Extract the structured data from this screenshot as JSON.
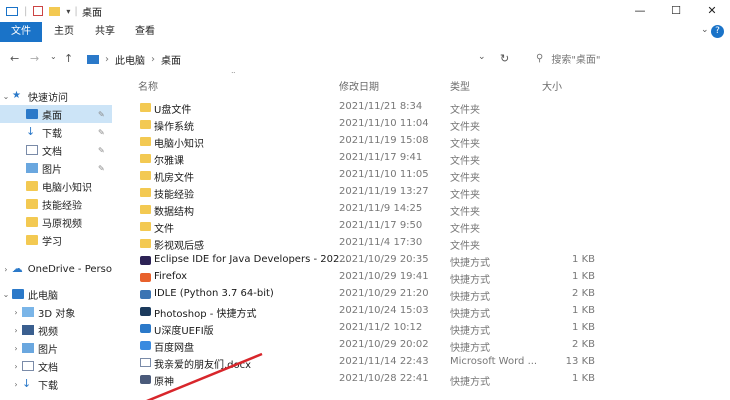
{
  "window": {
    "title": "桌面",
    "minimize": "—",
    "maximize": "☐",
    "close": "✕"
  },
  "ribbon": {
    "tabs": [
      "文件",
      "主页",
      "共享",
      "查看"
    ],
    "help": "?"
  },
  "address": {
    "crumbs": [
      "此电脑",
      "桌面"
    ],
    "search_placeholder": "搜索\"桌面\""
  },
  "nav": {
    "quick_access": "快速访问",
    "items": [
      {
        "label": "桌面",
        "pinned": true,
        "icon": "desktop-icon"
      },
      {
        "label": "下载",
        "pinned": true,
        "icon": "download-icon"
      },
      {
        "label": "文档",
        "pinned": true,
        "icon": "document-icon"
      },
      {
        "label": "图片",
        "pinned": true,
        "icon": "picture-icon"
      },
      {
        "label": "电脑小知识",
        "pinned": false,
        "icon": "folder-icon"
      },
      {
        "label": "技能经验",
        "pinned": false,
        "icon": "folder-icon"
      },
      {
        "label": "马原视频",
        "pinned": false,
        "icon": "folder-icon"
      },
      {
        "label": "学习",
        "pinned": false,
        "icon": "folder-icon"
      }
    ],
    "onedrive": "OneDrive - Perso",
    "this_pc": "此电脑",
    "pc_items": [
      {
        "label": "3D 对象",
        "icon": "3d-objects-icon"
      },
      {
        "label": "视频",
        "icon": "video-icon"
      },
      {
        "label": "图片",
        "icon": "picture-icon"
      },
      {
        "label": "文档",
        "icon": "document-icon"
      },
      {
        "label": "下载",
        "icon": "download-icon"
      }
    ]
  },
  "columns": {
    "name": "名称",
    "modified": "修改日期",
    "type": "类型",
    "size": "大小"
  },
  "files": [
    {
      "name": "U盘文件",
      "date": "2021/11/21 8:34",
      "type": "文件夹",
      "size": "",
      "icon": "folder"
    },
    {
      "name": "操作系统",
      "date": "2021/11/10 11:04",
      "type": "文件夹",
      "size": "",
      "icon": "folder"
    },
    {
      "name": "电脑小知识",
      "date": "2021/11/19 15:08",
      "type": "文件夹",
      "size": "",
      "icon": "folder"
    },
    {
      "name": "尔雅课",
      "date": "2021/11/17 9:41",
      "type": "文件夹",
      "size": "",
      "icon": "folder"
    },
    {
      "name": "机房文件",
      "date": "2021/11/10 11:05",
      "type": "文件夹",
      "size": "",
      "icon": "folder"
    },
    {
      "name": "技能经验",
      "date": "2021/11/19 13:27",
      "type": "文件夹",
      "size": "",
      "icon": "folder"
    },
    {
      "name": "数据结构",
      "date": "2021/11/9 14:25",
      "type": "文件夹",
      "size": "",
      "icon": "folder"
    },
    {
      "name": "文件",
      "date": "2021/11/17 9:50",
      "type": "文件夹",
      "size": "",
      "icon": "folder"
    },
    {
      "name": "影视观后感",
      "date": "2021/11/4 17:30",
      "type": "文件夹",
      "size": "",
      "icon": "folder"
    },
    {
      "name": "Eclipse IDE for Java Developers - 202...",
      "date": "2021/10/29 20:35",
      "type": "快捷方式",
      "size": "1 KB",
      "icon": "eclipse"
    },
    {
      "name": "Firefox",
      "date": "2021/10/29 19:41",
      "type": "快捷方式",
      "size": "1 KB",
      "icon": "firefox"
    },
    {
      "name": "IDLE (Python 3.7 64-bit)",
      "date": "2021/10/29 21:20",
      "type": "快捷方式",
      "size": "2 KB",
      "icon": "python"
    },
    {
      "name": "Photoshop - 快捷方式",
      "date": "2021/10/24 15:03",
      "type": "快捷方式",
      "size": "1 KB",
      "icon": "photoshop"
    },
    {
      "name": "U深度UEFI版",
      "date": "2021/11/2 10:12",
      "type": "快捷方式",
      "size": "1 KB",
      "icon": "udeep"
    },
    {
      "name": "百度网盘",
      "date": "2021/10/29 20:02",
      "type": "快捷方式",
      "size": "2 KB",
      "icon": "baidu"
    },
    {
      "name": "我亲爱的朋友们.docx",
      "date": "2021/11/14 22:43",
      "type": "Microsoft Word ...",
      "size": "13 KB",
      "icon": "word"
    },
    {
      "name": "原神",
      "date": "2021/10/28 22:41",
      "type": "快捷方式",
      "size": "1 KB",
      "icon": "genshin"
    }
  ],
  "colors": {
    "accent": "#1a73c8",
    "folder": "#f3c952",
    "annotation": "#d8262b"
  }
}
